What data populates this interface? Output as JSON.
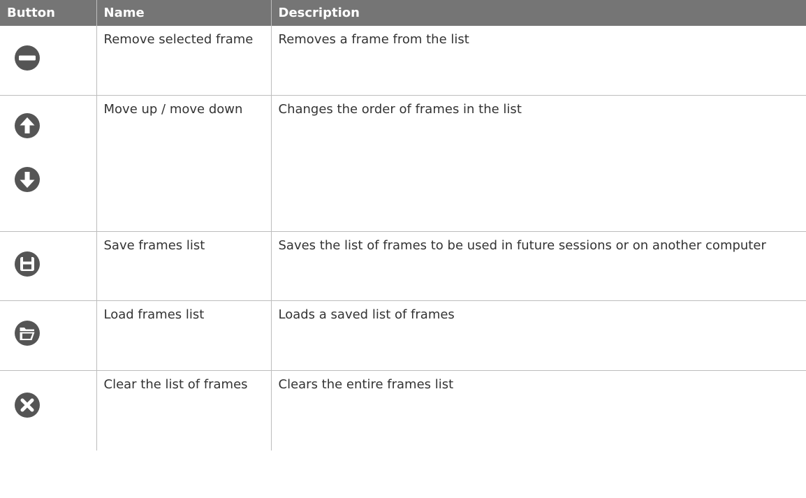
{
  "table": {
    "headers": {
      "button": "Button",
      "name": "Name",
      "description": "Description"
    },
    "rows": [
      {
        "icons": [
          "remove-icon"
        ],
        "name": "Remove selected frame",
        "description": "Removes a frame from the list"
      },
      {
        "icons": [
          "arrow-up-icon",
          "arrow-down-icon"
        ],
        "name": "Move up / move down",
        "description": "Changes the order of frames in the list"
      },
      {
        "icons": [
          "save-icon"
        ],
        "name": "Save frames list",
        "description": "Saves the list of frames to be used in future sessions or on another computer"
      },
      {
        "icons": [
          "load-icon"
        ],
        "name": "Load frames list",
        "description": "Loads a saved list of frames"
      },
      {
        "icons": [
          "clear-icon"
        ],
        "name": "Clear the list of frames",
        "description": "Clears the entire frames list"
      }
    ]
  },
  "colors": {
    "header_bg": "#757575",
    "header_text": "#ffffff",
    "icon": "#555555",
    "border": "#bdbdbd",
    "body_text": "#333333"
  }
}
